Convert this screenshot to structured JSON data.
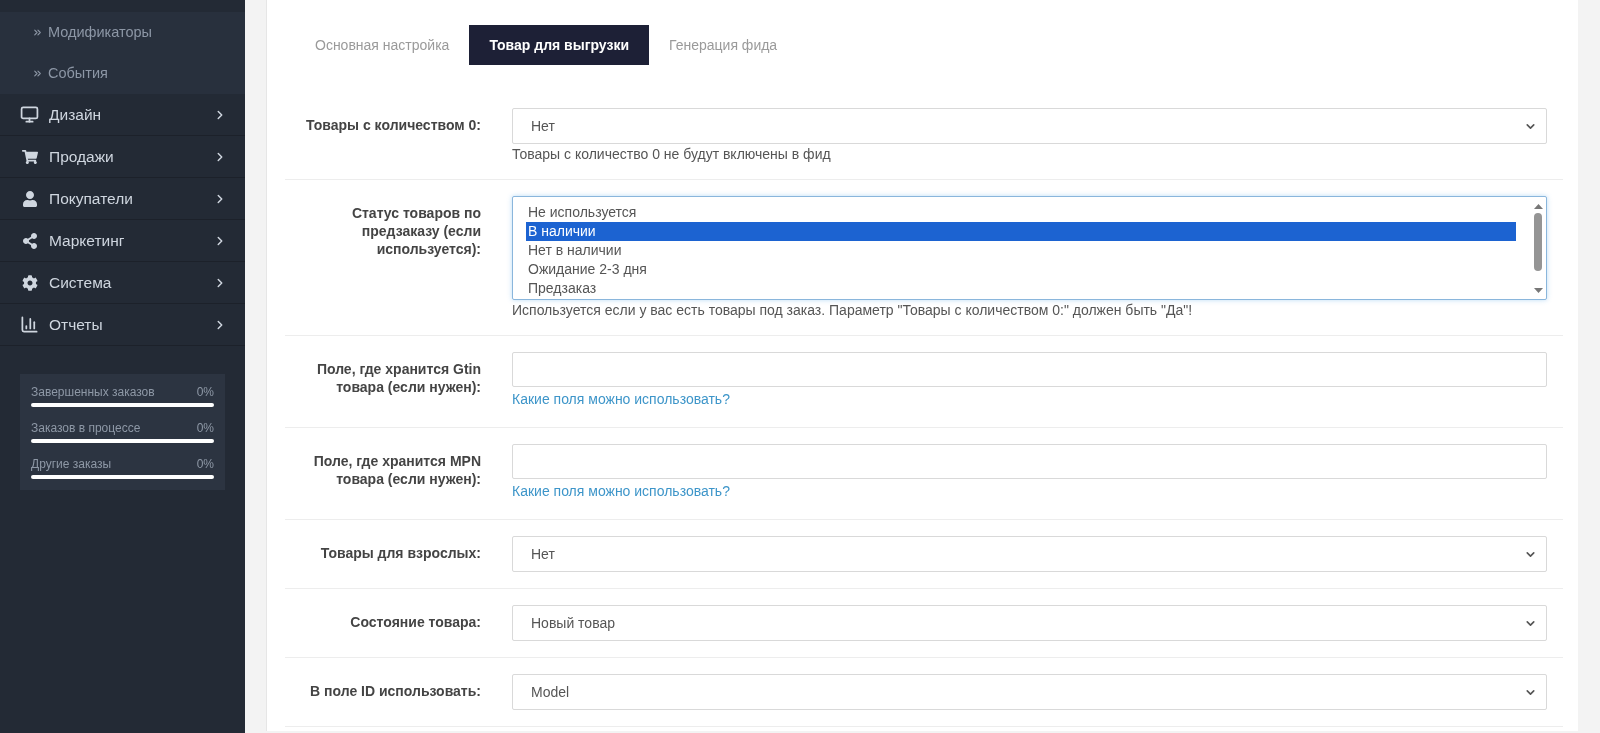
{
  "sidebar": {
    "subitems": [
      {
        "label": "Модификаторы"
      },
      {
        "label": "События"
      }
    ],
    "items": [
      {
        "label": "Дизайн"
      },
      {
        "label": "Продажи"
      },
      {
        "label": "Покупатели"
      },
      {
        "label": "Маркетинг"
      },
      {
        "label": "Система"
      },
      {
        "label": "Отчеты"
      }
    ],
    "stats": [
      {
        "label": "Завершенных заказов",
        "reading": "0%"
      },
      {
        "label": "Заказов в процессе",
        "reading": "0%"
      },
      {
        "label": "Другие заказы",
        "reading": "0%"
      }
    ]
  },
  "tabs": [
    {
      "label": "Основная настройка",
      "selected": false
    },
    {
      "label": "Товар для выгрузки",
      "selected": true
    },
    {
      "label": "Генерация фида",
      "selected": false
    }
  ],
  "form": {
    "rows": [
      {
        "kind": "select",
        "label": "Товары с количеством 0:",
        "value": "Нет",
        "help": "Товары с количество 0 не будут включены в фид"
      },
      {
        "kind": "listbox",
        "label": "Статус товаров по предзаказу (если используется):",
        "options": [
          {
            "label": "Не используется",
            "selected": false
          },
          {
            "label": "В наличии",
            "selected": true
          },
          {
            "label": "Нет в наличии",
            "selected": false
          },
          {
            "label": "Ожидание 2-3 дня",
            "selected": false
          },
          {
            "label": "Предзаказ",
            "selected": false
          }
        ],
        "help": "Используется если у вас есть товары под заказ. Параметр \"Товары с количеством 0:\" должен быть \"Да\"!"
      },
      {
        "kind": "input",
        "label": "Поле, где хранится Gtin товара (если нужен):",
        "link": "Какие поля можно использовать?"
      },
      {
        "kind": "input",
        "label": "Поле, где хранится MPN товара (если нужен):",
        "link": "Какие поля можно использовать?"
      },
      {
        "kind": "select",
        "label": "Товары для взрослых:",
        "value": "Нет"
      },
      {
        "kind": "select",
        "label": "Состояние товара:",
        "value": "Новый товар"
      },
      {
        "kind": "select",
        "label": "В поле ID использовать:",
        "value": "Model"
      }
    ]
  }
}
